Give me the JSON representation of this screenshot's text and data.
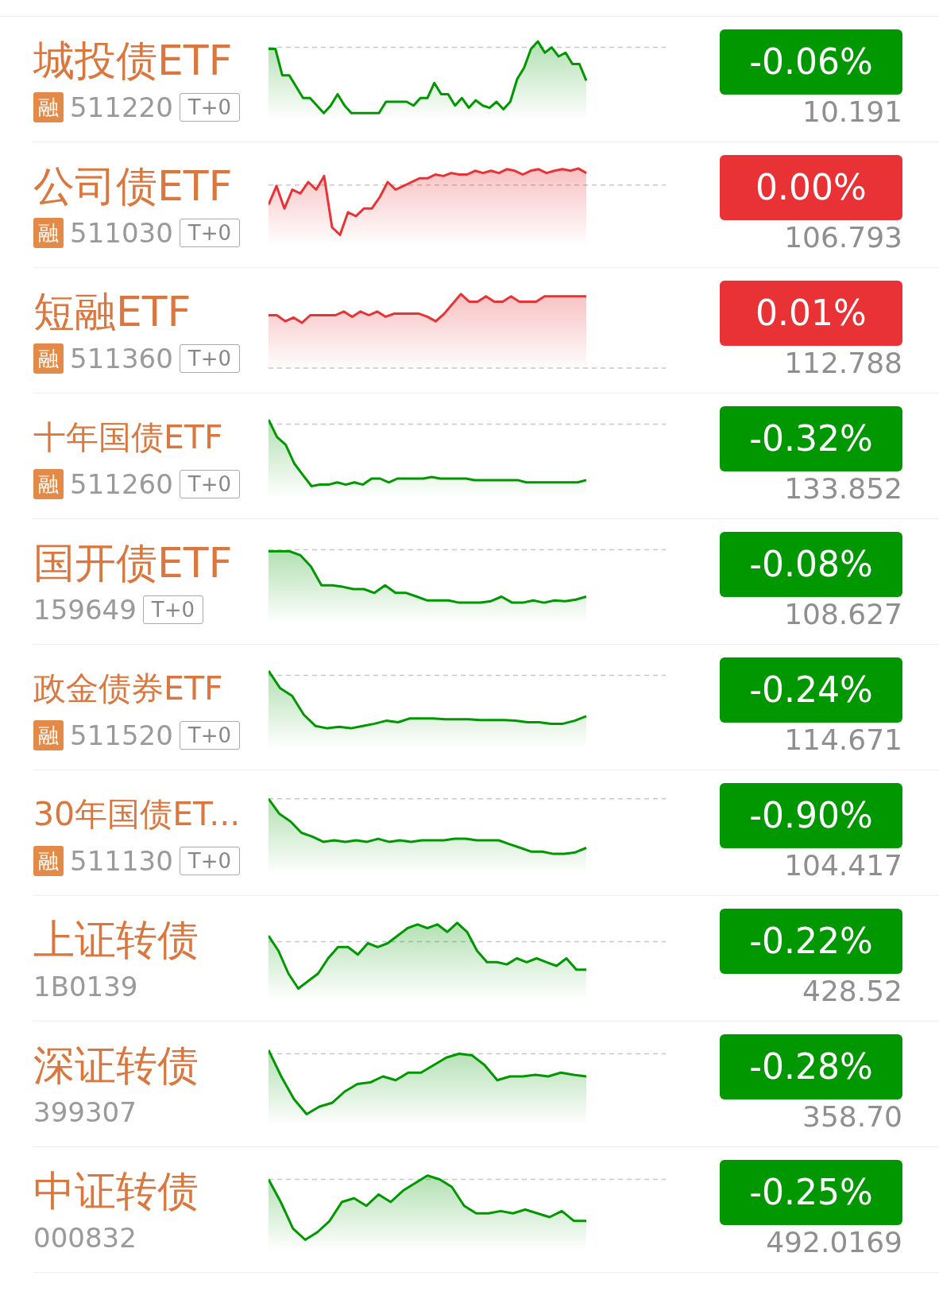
{
  "rows": [
    {
      "name": "城投债ETF",
      "tag": "融",
      "code": "511220",
      "badge": "T+0",
      "color": "#019701",
      "change": "-0.06%",
      "price": "10.191"
    },
    {
      "name": "公司债ETF",
      "tag": "融",
      "code": "511030",
      "badge": "T+0",
      "color": "#e93235",
      "change": "0.00%",
      "price": "106.793"
    },
    {
      "name": "短融ETF",
      "tag": "融",
      "code": "511360",
      "badge": "T+0",
      "color": "#e93235",
      "change": "0.01%",
      "price": "112.788"
    },
    {
      "name": "十年国债ETF",
      "tag": "融",
      "code": "511260",
      "badge": "T+0",
      "color": "#019701",
      "change": "-0.32%",
      "price": "133.852"
    },
    {
      "name": "国开债ETF",
      "code": "159649",
      "badge": "T+0",
      "color": "#019701",
      "change": "-0.08%",
      "price": "108.627"
    },
    {
      "name": "政金债券ETF",
      "tag": "融",
      "code": "511520",
      "badge": "T+0",
      "color": "#019701",
      "change": "-0.24%",
      "price": "114.671"
    },
    {
      "name": "30年国债ET...",
      "tag": "融",
      "code": "511130",
      "badge": "T+0",
      "color": "#019701",
      "change": "-0.90%",
      "price": "104.417"
    },
    {
      "name": "上证转债",
      "code": "1B0139",
      "color": "#019701",
      "change": "-0.22%",
      "price": "428.52"
    },
    {
      "name": "深证转债",
      "code": "399307",
      "color": "#019701",
      "change": "-0.28%",
      "price": "358.70"
    },
    {
      "name": "中证转债",
      "code": "000832",
      "color": "#019701",
      "change": "-0.25%",
      "price": "492.0169"
    }
  ]
}
